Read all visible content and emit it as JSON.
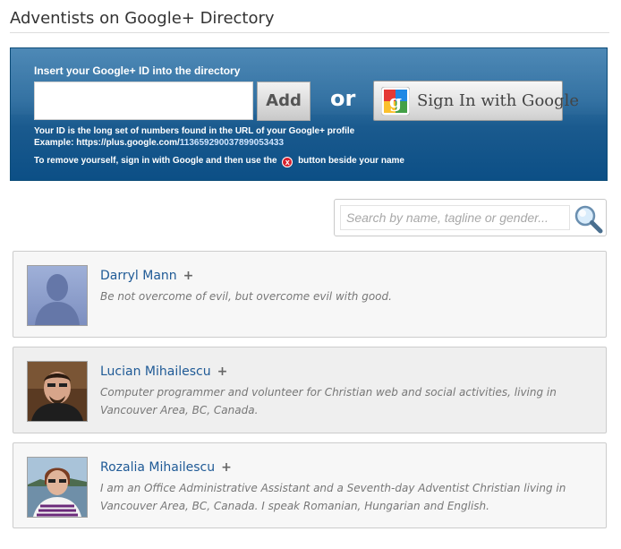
{
  "page": {
    "title": "Adventists on Google+ Directory"
  },
  "panel": {
    "heading": "Insert your Google+ ID into the directory",
    "id_input": {
      "value": "",
      "placeholder": ""
    },
    "add_button": "Add",
    "or_text": "or",
    "google_button": "Sign In with Google",
    "help_line1": "Your ID is the long set of numbers found in the URL of your Google+ profile",
    "example_prefix": "Example: https://plus.google.com/",
    "example_id": "113659290037899053433",
    "remove_prefix": "To remove yourself, sign in with Google and then use the",
    "remove_suffix": "button beside your name",
    "remove_glyph": "x"
  },
  "search": {
    "placeholder": "Search by name, tagline or gender...",
    "value": ""
  },
  "people": [
    {
      "name": "Darryl Mann",
      "tagline": "Be not overcome of evil, but overcome evil with good.",
      "avatar": "default-silhouette"
    },
    {
      "name": "Lucian Mihailescu",
      "tagline": "Computer programmer and volunteer for Christian web and social activities, living in Vancouver Area, BC, Canada.",
      "avatar": "photo-man"
    },
    {
      "name": "Rozalia Mihailescu",
      "tagline": "I am an Office Administrative Assistant and a Seventh-day Adventist Christian living in Vancouver Area, BC, Canada. I speak Romanian, Hungarian and English.",
      "avatar": "photo-woman"
    }
  ],
  "plus_glyph": "+",
  "colors": {
    "panel_blue": "#2d6d9f",
    "name_link": "#1f5a96",
    "remove_red": "#d8212e"
  }
}
